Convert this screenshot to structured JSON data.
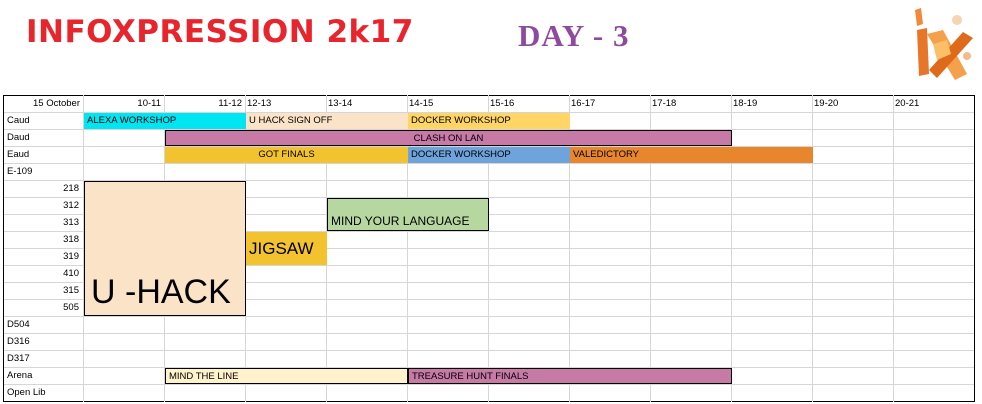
{
  "header": {
    "title": "INFOXPRESSION 2k17",
    "day": "DAY - 3"
  },
  "colors": {
    "title": "#e8242c",
    "day": "#8e4a9e",
    "cyan": "#00e5f2",
    "peach": "#fbe3c8",
    "yellow": "#ffd566",
    "mauve": "#c77aa6",
    "gold": "#f3c22f",
    "blue": "#6fa3dc",
    "orange": "#e8862d",
    "green": "#b7d7a0",
    "light_yellow": "#fff2cc"
  },
  "logo": {
    "icon": "ix-logo-icon"
  },
  "schedule": {
    "date_label": "15 October",
    "time_slots": [
      "10-11",
      "11-12",
      "12-13",
      "13-14",
      "14-15",
      "15-16",
      "16-17",
      "17-18",
      "18-19",
      "19-20",
      "20-21"
    ],
    "rooms": [
      "Caud",
      "Daud",
      "Eaud",
      "E-109",
      "218",
      "312",
      "313",
      "318",
      "319",
      "410",
      "315",
      "505",
      "D504",
      "D316",
      "D317",
      "Arena",
      "Open Lib"
    ],
    "events": {
      "alexa": "ALEXA WORKSHOP",
      "uhack_signoff": "U HACK SIGN OFF",
      "docker1": "DOCKER WORKSHOP",
      "clash": "CLASH   ON   LAN",
      "got": "GOT  FINALS",
      "docker2": "DOCKER WORKSHOP",
      "valedictory": "VALEDICTORY",
      "mind_language": "MIND YOUR LANGUAGE",
      "jigsaw": "JIGSAW",
      "uhack": "U -HACK",
      "mind_line": "MIND THE LINE",
      "treasure": "TREASURE HUNT FINALS"
    }
  }
}
